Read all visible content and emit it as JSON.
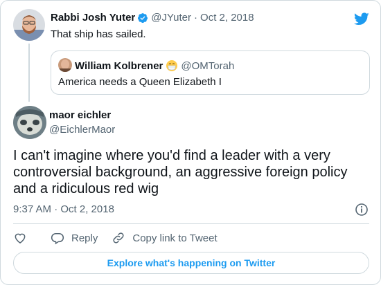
{
  "colors": {
    "accent": "#1d9bf0",
    "text": "#0f1419",
    "secondary": "#536471",
    "border": "#cfd9de"
  },
  "parent": {
    "name": "Rabbi Josh Yuter",
    "handle": "@JYuter",
    "separator": "·",
    "date": "Oct 2, 2018",
    "text": "That ship has sailed.",
    "verified_icon": "verified-badge-icon"
  },
  "quote": {
    "name": "William Kolbrener",
    "emoji_icon": "medical-mask-emoji-icon",
    "handle": "@OMTorah",
    "text": "America needs a Queen Elizabeth I"
  },
  "tweet": {
    "name": "maor eichler",
    "handle": "@EichlerMaor",
    "text": "I can't imagine where you'd find a leader with a very controversial background, an aggressive foreign policy and a ridiculous red wig",
    "time": "9:37 AM · Oct 2, 2018"
  },
  "actions": {
    "reply_label": "Reply",
    "copy_label": "Copy link to Tweet"
  },
  "footer": {
    "explore_label": "Explore what's happening on Twitter"
  }
}
